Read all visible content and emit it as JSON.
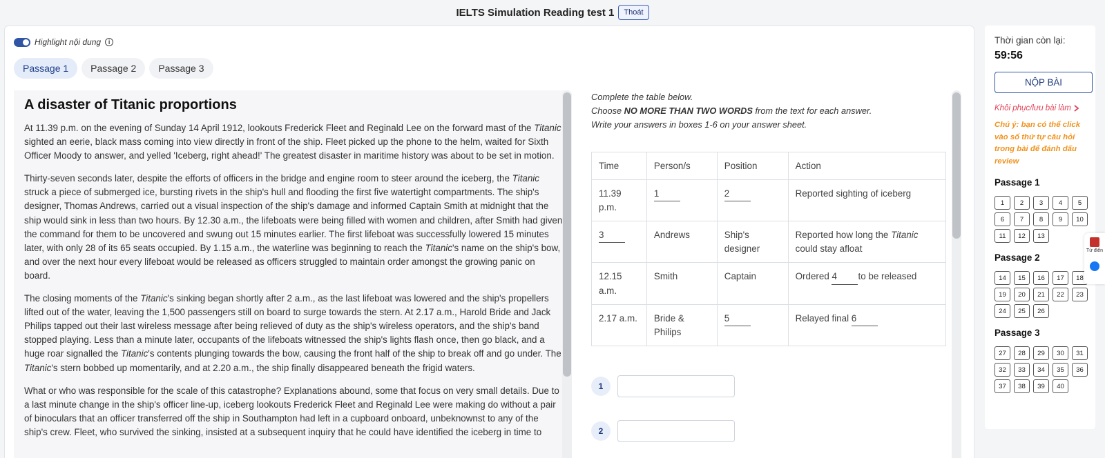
{
  "header": {
    "title": "IELTS Simulation Reading test 1",
    "exit_label": "Thoát"
  },
  "highlight": {
    "label": "Highlight nội dung",
    "info_glyph": "i",
    "enabled": true
  },
  "tabs": [
    "Passage 1",
    "Passage 2",
    "Passage 3"
  ],
  "active_tab": 0,
  "passage": {
    "title": "A disaster of Titanic proportions",
    "paragraphs": [
      "At 11.39 p.m. on the evening of Sunday 14 April 1912, lookouts Frederick Fleet and Reginald Lee on the forward mast of the <i>Titanic</i> sighted an eerie, black mass coming into view directly in front of the ship. Fleet picked up the phone to the helm, waited for Sixth Officer Moody to answer, and yelled 'Iceberg, right ahead!' The greatest disaster in maritime history was about to be set in motion.",
      "Thirty-seven seconds later, despite the efforts of officers in the bridge and engine room to steer around the iceberg, the <i>Titanic</i> struck a piece of submerged ice, bursting rivets in the ship's hull and flooding the first five watertight compartments. The ship's designer, Thomas Andrews, carried out a visual inspection of the ship's damage and informed Captain Smith at midnight that the ship would sink in less than two hours. By 12.30 a.m., the lifeboats were being filled with women and children, after Smith had given the command for them to be uncovered and swung out 15 minutes earlier. The first lifeboat was successfully lowered 15 minutes later, with only 28 of its 65 seats occupied. By 1.15 a.m., the waterline was beginning to reach the <i>Titanic</i>'s name on the ship's bow, and over the next hour every lifeboat would be released as officers struggled to maintain order amongst the growing panic on board.",
      "The closing moments of the <i>Titanic</i>'s sinking began shortly after 2 a.m., as the last lifeboat was lowered and the ship's propellers lifted out of the water, leaving the 1,500 passengers still on board to surge towards the stern. At 2.17 a.m., Harold Bride and Jack Philips tapped out their last wireless message after being relieved of duty as the ship's wireless operators, and the ship's band stopped playing. Less than a minute later, occupants of the lifeboats witnessed the ship's lights flash once, then go black, and a huge roar signalled the <i>Titanic</i>'s contents plunging towards the bow, causing the front half of the ship to break off and go under. The <i>Titanic</i>'s stern bobbed up momentarily, and at 2.20 a.m., the ship finally disappeared beneath the frigid waters.",
      "What or who was responsible for the scale of this catastrophe? Explanations abound, some that focus on very small details. Due to a last minute change in the ship's officer line-up, iceberg lookouts Frederick Fleet and Reginald Lee were making do without a pair of binoculars that an officer transferred off the ship in Southampton had left in a cupboard onboard, unbeknownst to any of the ship's crew. Fleet, who survived the sinking, insisted at a subsequent inquiry that he could have identified the iceberg in time to"
    ]
  },
  "questions": {
    "instructions_html": [
      "Complete the table below.",
      "Choose <b>NO MORE THAN TWO WORDS</b> from the text for each answer.",
      "Write your answers in boxes 1-6 on your answer sheet."
    ],
    "table_headers": [
      "Time",
      "Person/s",
      "Position",
      "Action"
    ],
    "table_rows_html": [
      [
        "11.39 p.m.",
        "<span class=\"blank\">1</span>",
        "<span class=\"blank\">2</span>",
        "Reported sighting of iceberg"
      ],
      [
        "<span class=\"blank\">3</span>",
        "Andrews",
        "Ship's designer",
        "Reported how long the <i>Titanic</i> could stay afloat"
      ],
      [
        "12.15 a.m.",
        "Smith",
        "Captain",
        "Ordered <span class=\"blank\">4</span>to be released"
      ],
      [
        "2.17 a.m.",
        "Bride &amp; Philips",
        "<span class=\"blank\">5</span>",
        "Relayed final <span class=\"blank\">6</span>"
      ]
    ],
    "answers": [
      {
        "number": "1",
        "value": ""
      },
      {
        "number": "2",
        "value": ""
      }
    ]
  },
  "sidebar": {
    "time_label": "Thời gian còn lại:",
    "time_value": "59:56",
    "submit_label": "NỘP BÀI",
    "restore_label": "Khôi phục/lưu bài làm",
    "note": "Chú ý: bạn có thể click vào số thứ tự câu hỏi trong bài để đánh dấu review",
    "groups": [
      {
        "title": "Passage 1",
        "numbers": [
          "1",
          "2",
          "3",
          "4",
          "5",
          "6",
          "7",
          "8",
          "9",
          "10",
          "11",
          "12",
          "13"
        ]
      },
      {
        "title": "Passage 2",
        "numbers": [
          "14",
          "15",
          "16",
          "17",
          "18",
          "19",
          "20",
          "21",
          "22",
          "23",
          "24",
          "25",
          "26"
        ]
      },
      {
        "title": "Passage 3",
        "numbers": [
          "27",
          "28",
          "29",
          "30",
          "31",
          "32",
          "33",
          "34",
          "35",
          "36",
          "37",
          "38",
          "39",
          "40"
        ]
      }
    ]
  },
  "float_widget": {
    "dictionary_label": "Từ điển"
  },
  "colors": {
    "accent": "#2f55a4",
    "tab_active_bg": "#e4ebf9",
    "restore": "#e0455b",
    "note": "#f0931e"
  }
}
